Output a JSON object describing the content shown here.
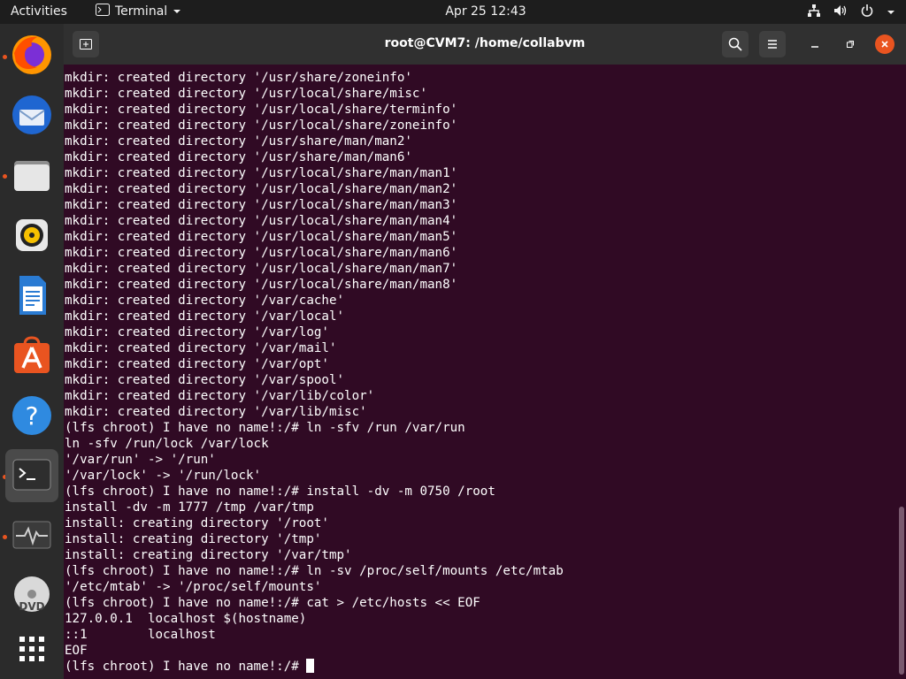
{
  "topbar": {
    "activities": "Activities",
    "app_name": "Terminal",
    "clock": "Apr 25  12:43"
  },
  "dock": {
    "items": [
      {
        "name": "firefox"
      },
      {
        "name": "thunderbird"
      },
      {
        "name": "files"
      },
      {
        "name": "rhythmbox"
      },
      {
        "name": "libreoffice-writer"
      },
      {
        "name": "ubuntu-software"
      },
      {
        "name": "help"
      },
      {
        "name": "terminal"
      },
      {
        "name": "system-monitor"
      },
      {
        "name": "dvd"
      },
      {
        "name": "show-applications"
      }
    ]
  },
  "window": {
    "title": "root@CVM7: /home/collabvm"
  },
  "terminal": {
    "lines": [
      "mkdir: created directory '/usr/share/zoneinfo'",
      "mkdir: created directory '/usr/local/share/misc'",
      "mkdir: created directory '/usr/local/share/terminfo'",
      "mkdir: created directory '/usr/local/share/zoneinfo'",
      "mkdir: created directory '/usr/share/man/man2'",
      "mkdir: created directory '/usr/share/man/man6'",
      "mkdir: created directory '/usr/local/share/man/man1'",
      "mkdir: created directory '/usr/local/share/man/man2'",
      "mkdir: created directory '/usr/local/share/man/man3'",
      "mkdir: created directory '/usr/local/share/man/man4'",
      "mkdir: created directory '/usr/local/share/man/man5'",
      "mkdir: created directory '/usr/local/share/man/man6'",
      "mkdir: created directory '/usr/local/share/man/man7'",
      "mkdir: created directory '/usr/local/share/man/man8'",
      "mkdir: created directory '/var/cache'",
      "mkdir: created directory '/var/local'",
      "mkdir: created directory '/var/log'",
      "mkdir: created directory '/var/mail'",
      "mkdir: created directory '/var/opt'",
      "mkdir: created directory '/var/spool'",
      "mkdir: created directory '/var/lib/color'",
      "mkdir: created directory '/var/lib/misc'",
      "(lfs chroot) I have no name!:/# ln -sfv /run /var/run",
      "ln -sfv /run/lock /var/lock",
      "'/var/run' -> '/run'",
      "'/var/lock' -> '/run/lock'",
      "(lfs chroot) I have no name!:/# install -dv -m 0750 /root",
      "install -dv -m 1777 /tmp /var/tmp",
      "install: creating directory '/root'",
      "install: creating directory '/tmp'",
      "install: creating directory '/var/tmp'",
      "(lfs chroot) I have no name!:/# ln -sv /proc/self/mounts /etc/mtab",
      "'/etc/mtab' -> '/proc/self/mounts'",
      "(lfs chroot) I have no name!:/# cat > /etc/hosts << EOF",
      "127.0.0.1  localhost $(hostname)",
      "::1        localhost",
      "EOF"
    ],
    "prompt": "(lfs chroot) I have no name!:/# "
  }
}
